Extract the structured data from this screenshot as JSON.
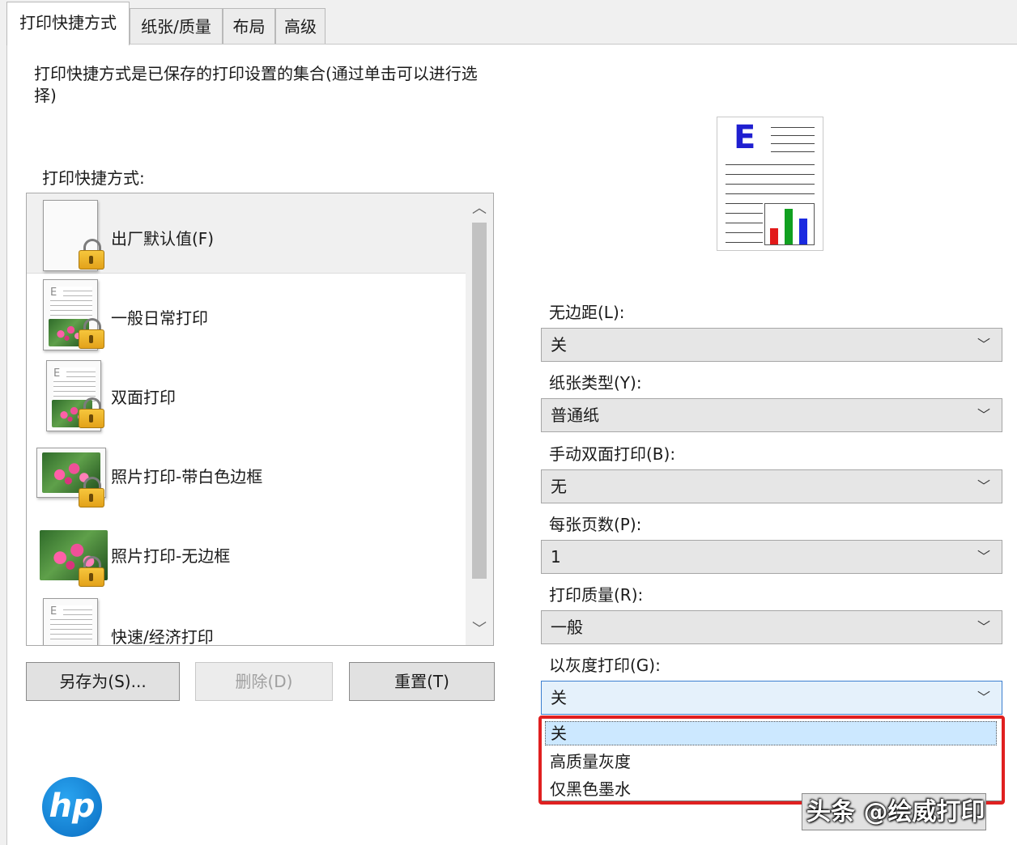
{
  "tabs": [
    "打印快捷方式",
    "纸张/质量",
    "布局",
    "高级"
  ],
  "description": "打印快捷方式是已保存的打印设置的集合(通过单击可以进行选择)",
  "shortcuts_label": "打印快捷方式:",
  "shortcuts": [
    {
      "label": "出厂默认值(F)",
      "icon": "blank-page-icon"
    },
    {
      "label": "一般日常打印",
      "icon": "document-photo-icon"
    },
    {
      "label": "双面打印",
      "icon": "duplex-page-icon"
    },
    {
      "label": "照片打印-带白色边框",
      "icon": "photo-border-icon"
    },
    {
      "label": "照片打印-无边框",
      "icon": "photo-borderless-icon"
    },
    {
      "label": "快速/经济打印",
      "icon": "economy-page-icon"
    }
  ],
  "buttons": {
    "save_as": "另存为(S)...",
    "delete": "删除(D)",
    "reset": "重置(T)"
  },
  "preview": {
    "letter": "E"
  },
  "settings": [
    {
      "label": "无边距(L):",
      "value": "关"
    },
    {
      "label": "纸张类型(Y):",
      "value": "普通纸"
    },
    {
      "label": "手动双面打印(B):",
      "value": "无"
    },
    {
      "label": "每张页数(P):",
      "value": "1"
    },
    {
      "label": "打印质量(R):",
      "value": "一般"
    },
    {
      "label": "以灰度打印(G):",
      "value": "关"
    }
  ],
  "grayscale_options": [
    "关",
    "高质量灰度",
    "仅黑色墨水"
  ],
  "logo_text": "hp",
  "watermark": "头条 @绘威打印",
  "colors": {
    "highlight": "#e02020",
    "selected_option": "#cce8ff",
    "hp_blue": "#0a6ec2"
  }
}
